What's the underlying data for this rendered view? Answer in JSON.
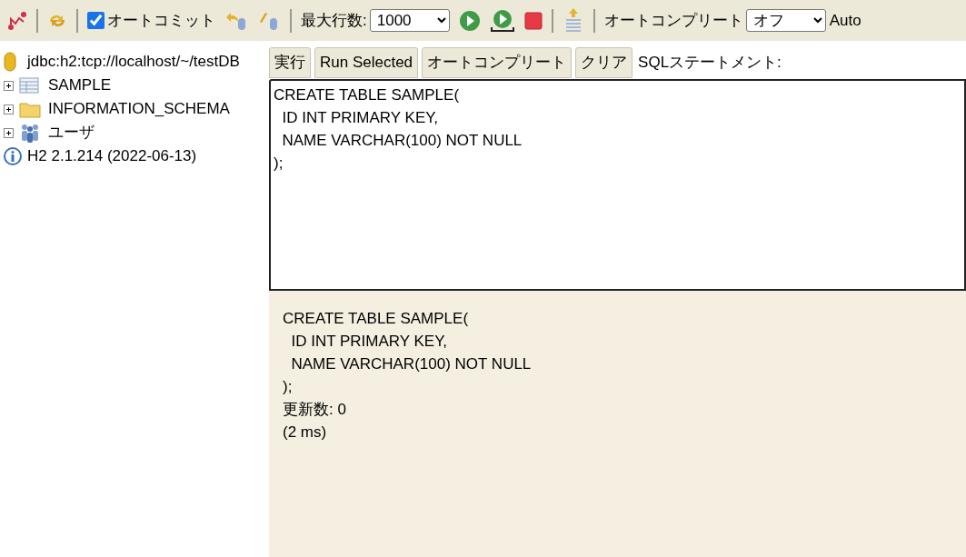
{
  "toolbar": [
    {
      "kind": "icon"
    },
    {
      "kind": "separator"
    },
    {
      "kind": "icon"
    },
    {
      "kind": "separator"
    },
    {
      "kind": "checkbox",
      "label": "オートコミット",
      "checked": true
    },
    {
      "kind": "icon"
    },
    {
      "kind": "icon"
    },
    {
      "kind": "separator"
    },
    {
      "kind": "select",
      "label": "最大行数:",
      "value": "1000"
    },
    {
      "kind": "icon"
    },
    {
      "kind": "icon"
    },
    {
      "kind": "icon"
    },
    {
      "kind": "separator"
    },
    {
      "kind": "icon"
    },
    {
      "kind": "separator"
    },
    {
      "kind": "select",
      "label": "オートコンプリート",
      "value": "オフ"
    },
    {
      "kind": "text",
      "label": "Auto"
    }
  ],
  "tree": {
    "connection": "jdbc:h2:tcp://localhost/~/testDB",
    "nodes": [
      {
        "kind": "table",
        "label": "SAMPLE",
        "expanded": false
      },
      {
        "kind": "folder",
        "label": "INFORMATION_SCHEMA",
        "expanded": false
      },
      {
        "kind": "users",
        "label": "ユーザ",
        "expanded": false
      }
    ],
    "version": "H2 2.1.214 (2022-06-13)"
  },
  "buttons": [
    "実行",
    "Run Selected",
    "オートコンプリート",
    "クリア"
  ],
  "statement_label": "SQLステートメント:",
  "editor": {
    "value": "CREATE TABLE SAMPLE(\n  ID INT PRIMARY KEY,\n  NAME VARCHAR(100) NOT NULL\n);"
  },
  "result": [
    "CREATE TABLE SAMPLE(",
    "  ID INT PRIMARY KEY,",
    "  NAME VARCHAR(100) NOT NULL",
    ");",
    "更新数: 0",
    "(2 ms)"
  ]
}
